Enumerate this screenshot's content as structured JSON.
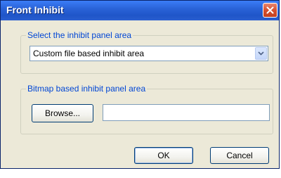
{
  "window": {
    "title": "Front Inhibit",
    "close_icon": "close-icon"
  },
  "colors": {
    "titlebar": "#2a63d8",
    "group_label": "#0046d5",
    "close_button": "#d6502f",
    "dialog_bg": "#ece9d8"
  },
  "panel_area_group": {
    "label": "Select the inhibit panel area",
    "selected_value": "Custom file based inhibit area",
    "dropdown_icon": "chevron-down-icon"
  },
  "bitmap_group": {
    "label": "Bitmap based inhibit panel area",
    "browse_label": "Browse...",
    "path_value": ""
  },
  "buttons": {
    "ok_label": "OK",
    "cancel_label": "Cancel"
  }
}
